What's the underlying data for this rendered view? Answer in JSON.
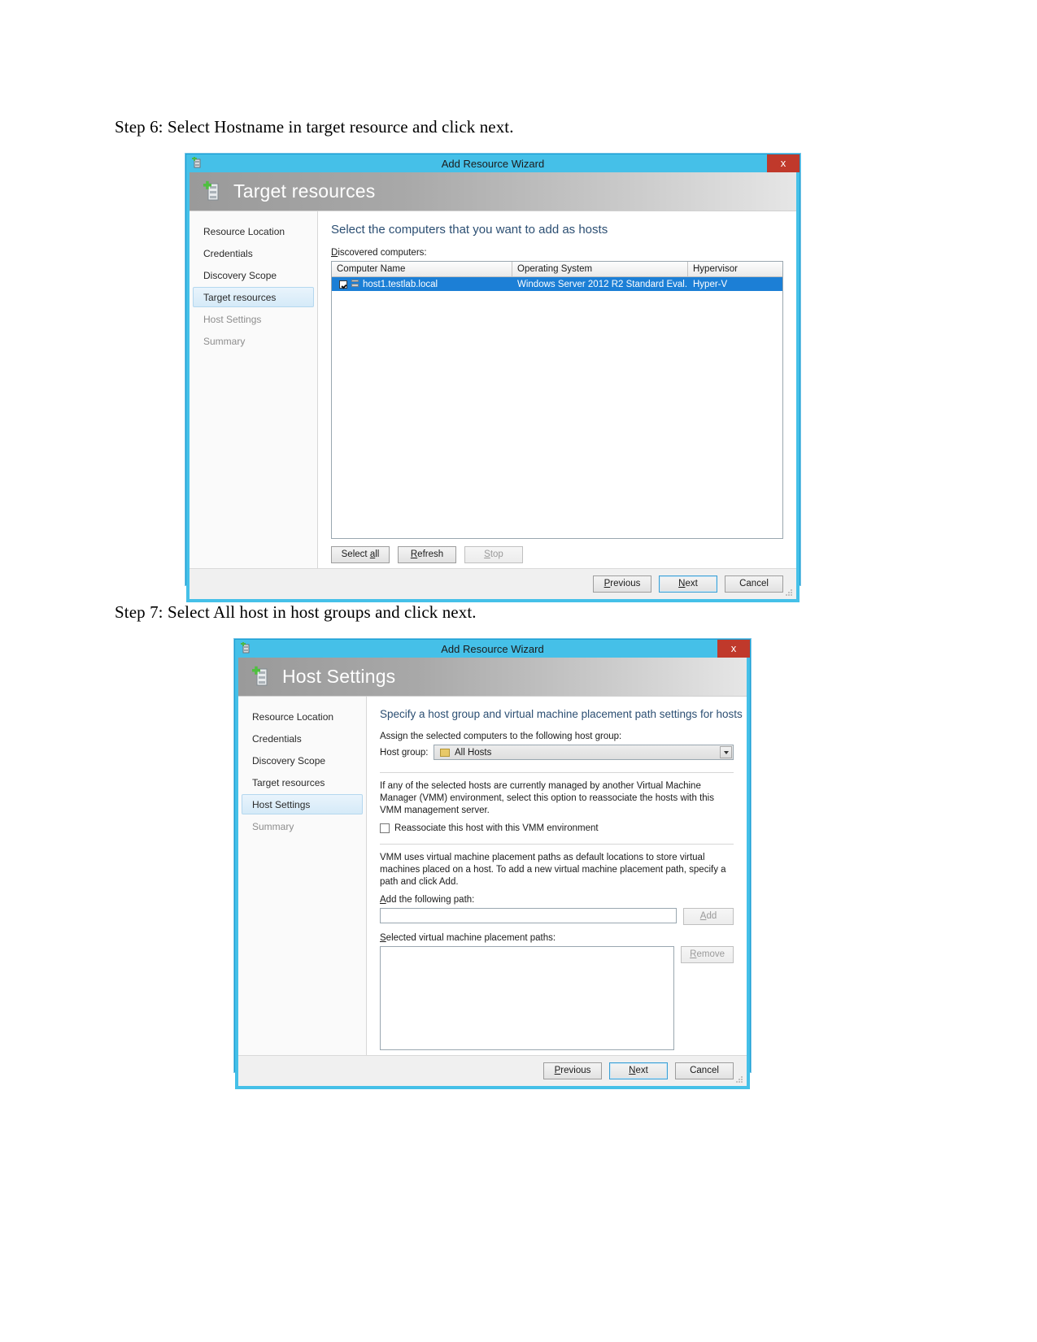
{
  "page": {
    "step6_text": "Step 6: Select Hostname in target resource and click next.",
    "step7_text": "Step 7: Select All host in host groups and click next."
  },
  "colors": {
    "titlebar": "#45c0e8",
    "close_button": "#c0392b",
    "selection_blue": "#1c7fd6",
    "heading_blue": "#2c4f73"
  },
  "dialog1": {
    "window_title": "Add Resource Wizard",
    "close_label": "x",
    "header_title": "Target resources",
    "header_icon": "server-add-icon",
    "nav": [
      {
        "label": "Resource Location",
        "state": "normal"
      },
      {
        "label": "Credentials",
        "state": "normal"
      },
      {
        "label": "Discovery Scope",
        "state": "normal"
      },
      {
        "label": "Target resources",
        "state": "selected"
      },
      {
        "label": "Host Settings",
        "state": "dim"
      },
      {
        "label": "Summary",
        "state": "dim"
      }
    ],
    "main_heading": "Select the computers that you want to add as hosts",
    "list_label": "Discovered computers:",
    "list_label_accel": "D",
    "table": {
      "columns": [
        "Computer Name",
        "Operating System",
        "Hypervisor"
      ],
      "rows": [
        {
          "checked": true,
          "computer_name": "host1.testlab.local",
          "operating_system": "Windows Server 2012 R2 Standard Eval...",
          "hypervisor": "Hyper-V",
          "selected": true
        }
      ]
    },
    "table_buttons": [
      {
        "label": "Select all",
        "accel": "a",
        "enabled": true
      },
      {
        "label": "Refresh",
        "accel": "R",
        "enabled": true
      },
      {
        "label": "Stop",
        "accel": "S",
        "enabled": false
      }
    ],
    "footer_buttons": [
      {
        "label": "Previous",
        "accel": "P",
        "default": false
      },
      {
        "label": "Next",
        "accel": "N",
        "default": true
      },
      {
        "label": "Cancel",
        "accel": "",
        "default": false
      }
    ]
  },
  "dialog2": {
    "window_title": "Add Resource Wizard",
    "close_label": "x",
    "header_title": "Host Settings",
    "header_icon": "server-add-icon",
    "nav": [
      {
        "label": "Resource Location",
        "state": "normal"
      },
      {
        "label": "Credentials",
        "state": "normal"
      },
      {
        "label": "Discovery Scope",
        "state": "normal"
      },
      {
        "label": "Target resources",
        "state": "normal"
      },
      {
        "label": "Host Settings",
        "state": "selected"
      },
      {
        "label": "Summary",
        "state": "dim"
      }
    ],
    "main_heading": "Specify a host group and virtual machine placement path settings for hosts",
    "assign_label": "Assign the selected computers to the following host group:",
    "host_group_label": "Host group:",
    "host_group_accel": "H",
    "host_group_value": "All Hosts",
    "host_group_icon": "folder-icon",
    "reassociate_paragraph": "If any of the selected hosts are currently managed by another Virtual Machine Manager (VMM) environment, select this option to reassociate the hosts with this VMM management server.",
    "reassociate_checkbox_label": "Reassociate this host with this VMM environment",
    "reassociate_checked": false,
    "placement_paragraph": "VMM uses virtual machine placement paths as default locations to store virtual machines placed on a host. To add a new virtual machine placement path, specify a path and click Add.",
    "add_path_label": "Add the following path:",
    "add_path_accel": "A",
    "add_path_value": "",
    "add_button": {
      "label": "Add",
      "accel": "A",
      "enabled": false
    },
    "selected_paths_label": "Selected virtual machine placement paths:",
    "selected_paths_accel": "S",
    "remove_button": {
      "label": "Remove",
      "accel": "R",
      "enabled": false
    },
    "selected_paths": [],
    "footer_buttons": [
      {
        "label": "Previous",
        "accel": "P",
        "default": false
      },
      {
        "label": "Next",
        "accel": "N",
        "default": true
      },
      {
        "label": "Cancel",
        "accel": "",
        "default": false
      }
    ]
  }
}
